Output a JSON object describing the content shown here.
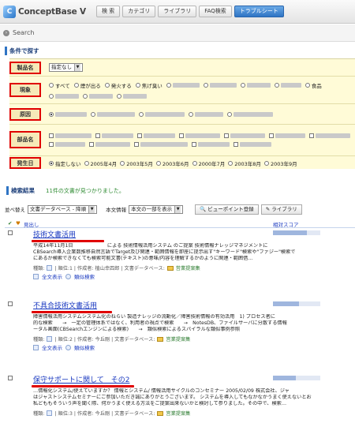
{
  "app": {
    "name": "ConceptBase V",
    "logo_mark": "C"
  },
  "nav_tabs": [
    "検 索",
    "カテゴリ",
    "ライブラリ",
    "FAQ検索",
    "トラブルシート"
  ],
  "nav_active": "トラブルシート",
  "search_bar": {
    "label": "Search"
  },
  "conditions": {
    "title": "条件で探す",
    "rows": [
      {
        "label": "製品名",
        "value": "指定なし"
      },
      {
        "label": "現象",
        "options": [
          "すべて",
          "煙が出る",
          "発火する",
          "焦げ臭い",
          "食品"
        ]
      },
      {
        "label": "原因"
      },
      {
        "label": "部品名"
      },
      {
        "label": "発生日",
        "options": [
          "指定しない",
          "2005年4月",
          "2003年5月",
          "2003年6月",
          "2000年7月",
          "2003年8月",
          "2003年9月"
        ]
      }
    ]
  },
  "results": {
    "title": "検索結果",
    "count_text": "11件の文書が見つかりました。",
    "sort_label": "並べ替え",
    "sort_value": "文書データベース - 降順",
    "body_label": "本文情報",
    "body_value": "本文の一部を表示",
    "viewpoint_button": "ビューポイント登録",
    "library_button": "ライブラリ",
    "header_label": "見出し",
    "score_label": "相対スコア",
    "items": [
      {
        "title": "技術文書活用",
        "snippet1": "平成14年11月1日　　　　　　　による 技術情報活用システム のご提案 技術情報ナレッジマネジメントに",
        "snippet2": "CBSearch導入企業数推移自然言語でTarget及び関連・範囲情報を即座に提示出す\"キーワード\"検索や\"ファジー\"検索で",
        "snippet3": "にあるか検索できなくても検索可能文書(テキスト)の意味/内容を理解するかのように関連・範囲借...",
        "meta": [
          "種類:",
          "| 順位:1 | 作成者: 植山幸四郎 | 文書データベース:",
          "営業提案集"
        ],
        "actions": [
          "全文表示",
          "類似検索"
        ],
        "score": 0.72
      },
      {
        "title": "不具合技術文書活用",
        "snippet1": "障害情報活用システムシステム化のねらい 製造ナレッジの流動化／障害技術情報の有効活用　1) プロセス者に",
        "snippet2": "的な検索　　→　一定の管理体系ではなく、利用者の視点で検索　　→　NotesDB、ファイルサーバに分散する情報",
        "snippet3": "ータル画面(CBSearchエンジンによる検索)　　→　類似検索によるスパイラルな類似事例参照",
        "meta": [
          "種類:",
          "| 順位:2 | 作成者: 今丘剛 | 文書データベース:",
          "営業提案集"
        ],
        "actions": [
          "全文表示",
          "類似検索"
        ],
        "score": 0.55
      },
      {
        "title": "保守サポートに関して　その2",
        "snippet1": "…情報化システム/使えていますか？ 情報とシステム/ 情報活用サイクルのコンセミナー 2005/02/09 株式会社、ジャ",
        "snippet2": "はジャストシステムセミナーにご参加いただき誠にありがとうございます。 システムを導入してもなかなかうまく使えないとお",
        "snippet3": "私どももそういう声を聞く際、何かうまく使える方法をご提案出来ないかと検討して参りました。その中で、検索…",
        "meta": [
          "種類:",
          "| 順位:3 | 作成者: 今丘剛 | 文書データベース:",
          "営業提案集"
        ],
        "actions": [],
        "score": 0.48
      }
    ]
  },
  "icons": {
    "logo": "concept-logo-icon",
    "search": "search-circle-icon",
    "folder": "folder-icon",
    "doc": "doc-icon"
  },
  "colors": {
    "highlight": "#e00000",
    "accent": "#2f74c4",
    "condition_bg": "#fffbd7"
  }
}
